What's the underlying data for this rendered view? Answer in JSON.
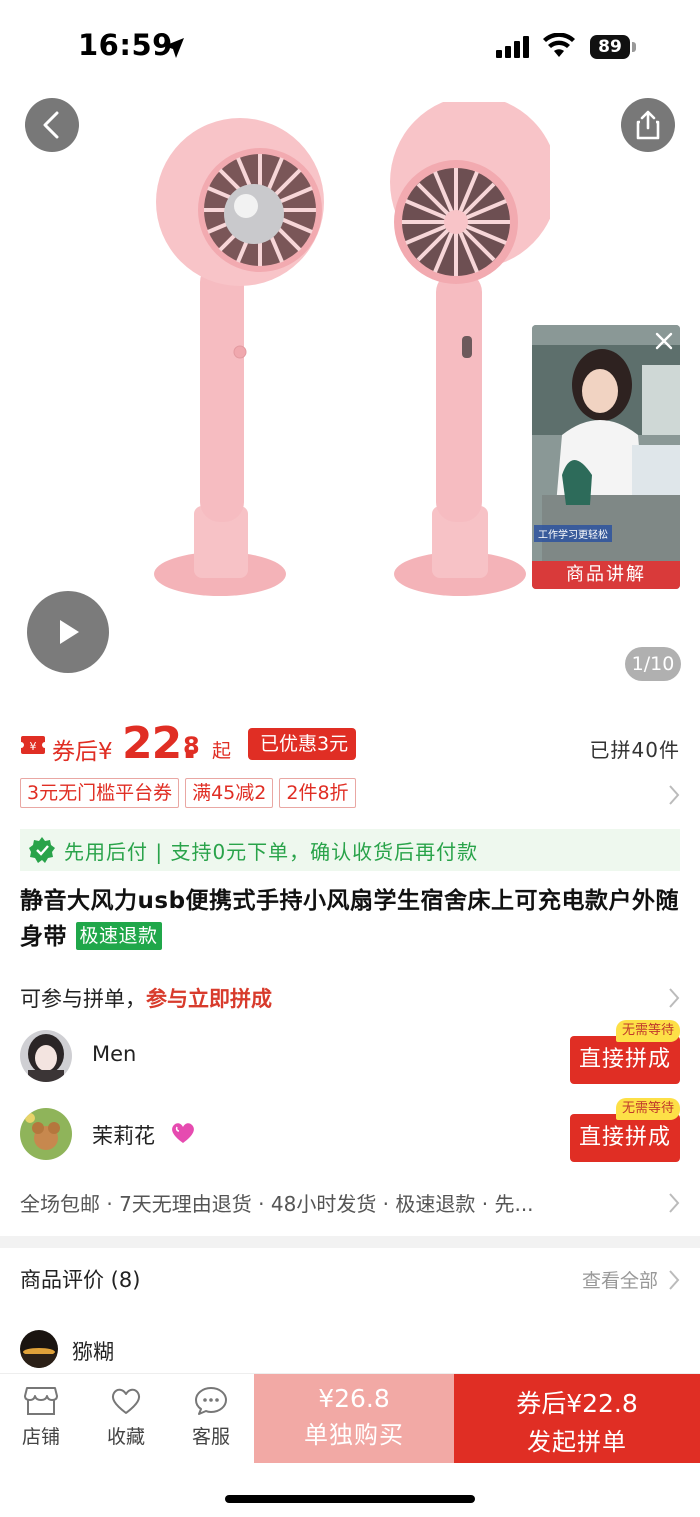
{
  "status_bar": {
    "time": "16:59",
    "battery": "89"
  },
  "gallery": {
    "counter": "1/10",
    "video_label": "商品讲解",
    "video_caption": "工作学习更轻松"
  },
  "price": {
    "prefix": "券后¥",
    "integer": "22.",
    "decimal": "8",
    "suffix": "起",
    "discount_badge": "已优惠3元",
    "sold": "已拼40件"
  },
  "tags": [
    "3元无门槛平台券",
    "满45减2",
    "2件8折"
  ],
  "paylater": {
    "text": "先用后付 | 支持0元下单，确认收货后再付款"
  },
  "product": {
    "title": "静音大风力usb便携式手持小风扇学生宿舍床上可充电款户外随身带",
    "badge": "极速退款"
  },
  "group_buy": {
    "intro": "可参与拼单，",
    "intro_highlight": "参与立即拼成",
    "rows": [
      {
        "name": "Men",
        "button": "直接拼成",
        "tag": "无需等待"
      },
      {
        "name": "茉莉花",
        "button": "直接拼成",
        "tag": "无需等待"
      }
    ]
  },
  "services": {
    "text": "全场包邮 · 7天无理由退货 · 48小时发货 · 极速退款 · 先..."
  },
  "reviews": {
    "title": "商品评价 (8)",
    "view_all": "查看全部",
    "first_reviewer": "猕糊"
  },
  "bottom_bar": {
    "shop": "店铺",
    "favorite": "收藏",
    "service": "客服",
    "solo_price": "¥26.8",
    "solo_label": "单独购买",
    "group_price": "券后¥22.8",
    "group_label": "发起拼单"
  },
  "colors": {
    "brand_red": "#e02e24",
    "green": "#20a74a",
    "solo_pink": "#f2a9a5",
    "fan_pink": "#f6b9bd"
  }
}
